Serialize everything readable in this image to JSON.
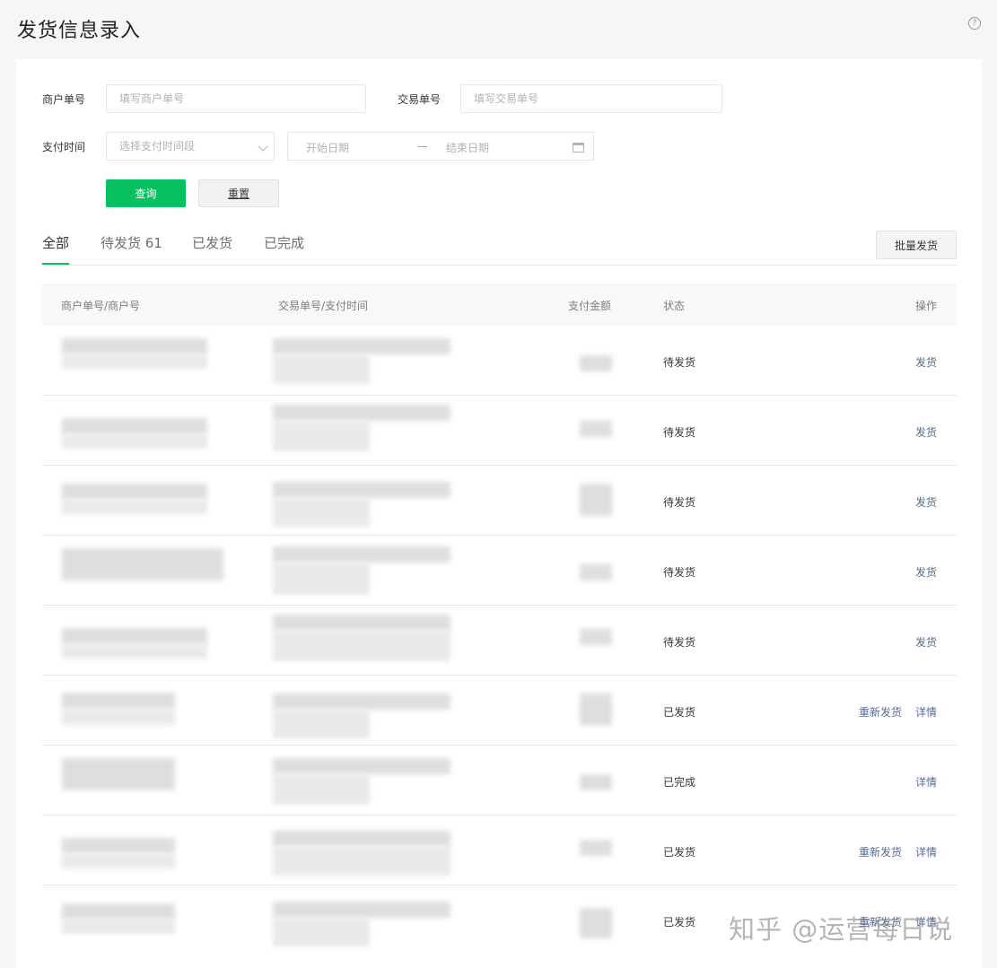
{
  "page": {
    "title": "发货信息录入",
    "help_icon": "?"
  },
  "filters": {
    "merchant_order_label": "商户单号",
    "merchant_order_placeholder": "填写商户单号",
    "trade_order_label": "交易单号",
    "trade_order_placeholder": "填写交易单号",
    "pay_time_label": "支付时间",
    "pay_time_select_placeholder": "选择支付时间段",
    "start_date_placeholder": "开始日期",
    "date_separator": "—",
    "end_date_placeholder": "结束日期",
    "query_button": "查询",
    "reset_button": "重置"
  },
  "tabs": [
    {
      "label": "全部",
      "active": true
    },
    {
      "label": "待发货 61",
      "active": false
    },
    {
      "label": "已发货",
      "active": false
    },
    {
      "label": "已完成",
      "active": false
    }
  ],
  "batch_button": "批量发货",
  "table": {
    "headers": [
      "商户单号/商户号",
      "交易单号/支付时间",
      "支付金额",
      "状态",
      "操作"
    ],
    "rows": [
      {
        "status": "待发货",
        "actions": [
          "发货"
        ]
      },
      {
        "status": "待发货",
        "actions": [
          "发货"
        ]
      },
      {
        "status": "待发货",
        "actions": [
          "发货"
        ]
      },
      {
        "status": "待发货",
        "actions": [
          "发货"
        ]
      },
      {
        "status": "待发货",
        "actions": [
          "发货"
        ]
      },
      {
        "status": "已发货",
        "actions": [
          "重新发货",
          "详情"
        ]
      },
      {
        "status": "已完成",
        "actions": [
          "详情"
        ]
      },
      {
        "status": "已发货",
        "actions": [
          "重新发货",
          "详情"
        ]
      },
      {
        "status": "已发货",
        "actions": [
          "重新发货",
          "详情"
        ]
      }
    ]
  },
  "watermark": "知乎 @运营每日说",
  "colors": {
    "primary": "#07c160",
    "link": "#576b95"
  }
}
